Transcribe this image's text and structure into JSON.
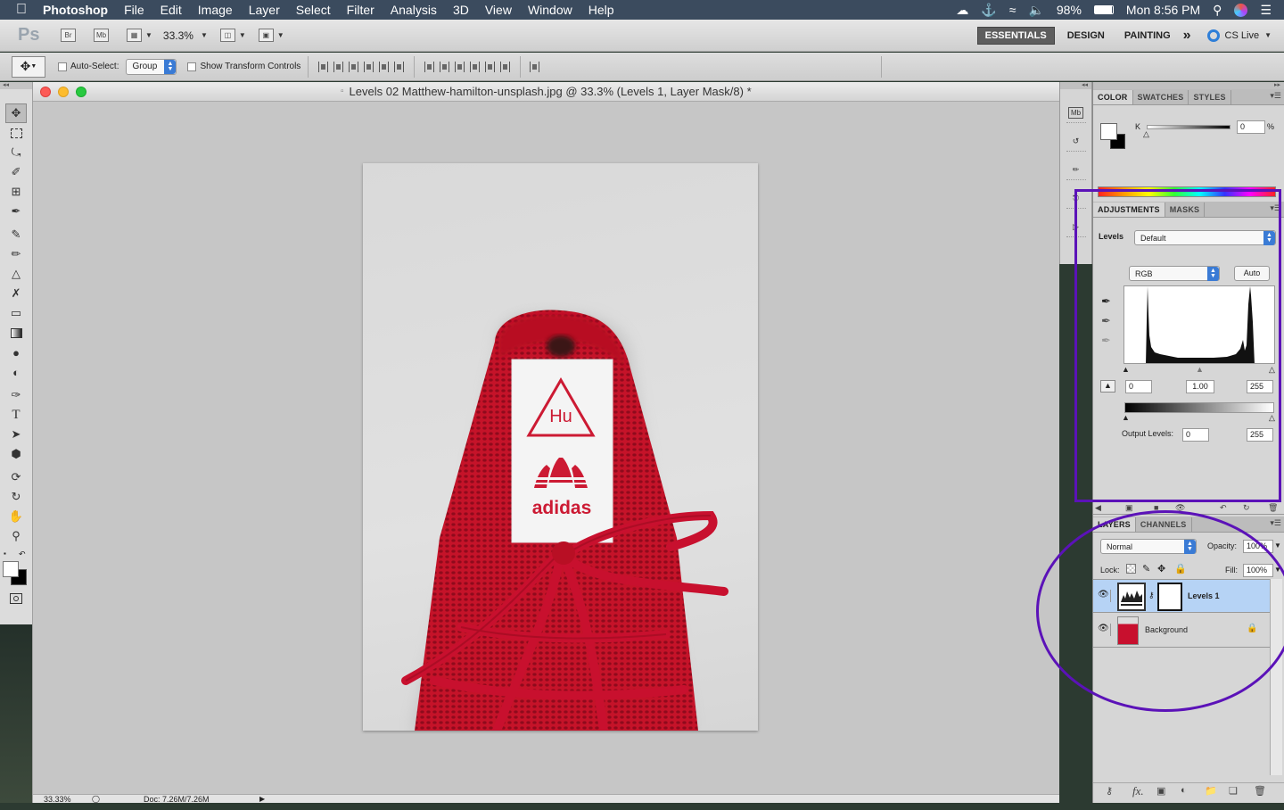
{
  "menubar": {
    "app": "Photoshop",
    "items": [
      "File",
      "Edit",
      "Image",
      "Layer",
      "Select",
      "Filter",
      "Analysis",
      "3D",
      "View",
      "Window",
      "Help"
    ],
    "battery": "98%",
    "clock": "Mon 8:56 PM"
  },
  "appbar": {
    "logo": "Ps",
    "bridge": "Br",
    "minibridge": "Mb",
    "zoom": "33.3%",
    "workspaces": [
      "ESSENTIALS",
      "DESIGN",
      "PAINTING"
    ],
    "more": "»",
    "cs_live": "CS Live"
  },
  "options": {
    "auto_select_label": "Auto-Select:",
    "auto_select_value": "Group",
    "show_transform_label": "Show Transform Controls"
  },
  "document": {
    "title": "Levels 02 Matthew-hamilton-unsplash.jpg @ 33.3% (Levels 1, Layer Mask/8) *",
    "tag_text": "Hu",
    "brand_text": "adidas",
    "status_zoom": "33.33%",
    "status_doc": "Doc: 7.26M/7.26M"
  },
  "color_panel": {
    "tabs": [
      "COLOR",
      "SWATCHES",
      "STYLES"
    ],
    "channel": "K",
    "value": "0",
    "unit": "%"
  },
  "adjustments_panel": {
    "tabs": [
      "ADJUSTMENTS",
      "MASKS"
    ],
    "type_label": "Levels",
    "preset": "Default",
    "channel": "RGB",
    "auto_label": "Auto",
    "input_black": "0",
    "input_gamma": "1.00",
    "input_white": "255",
    "output_label": "Output Levels:",
    "output_black": "0",
    "output_white": "255"
  },
  "layers_panel": {
    "tabs": [
      "LAYERS",
      "CHANNELS"
    ],
    "blend_mode": "Normal",
    "opacity_label": "Opacity:",
    "opacity": "100%",
    "lock_label": "Lock:",
    "fill_label": "Fill:",
    "fill": "100%",
    "layers": [
      {
        "name": "Levels 1",
        "selected": true
      },
      {
        "name": "Background",
        "selected": false
      }
    ],
    "footer_fx": "fx."
  },
  "colors": {
    "menubar": "#3b4b5e",
    "canvas_bg": "#c6c6c6",
    "shoe_red": "#c8102e",
    "annotation": "#5b12b8",
    "selected_layer": "#b6d3f5"
  }
}
